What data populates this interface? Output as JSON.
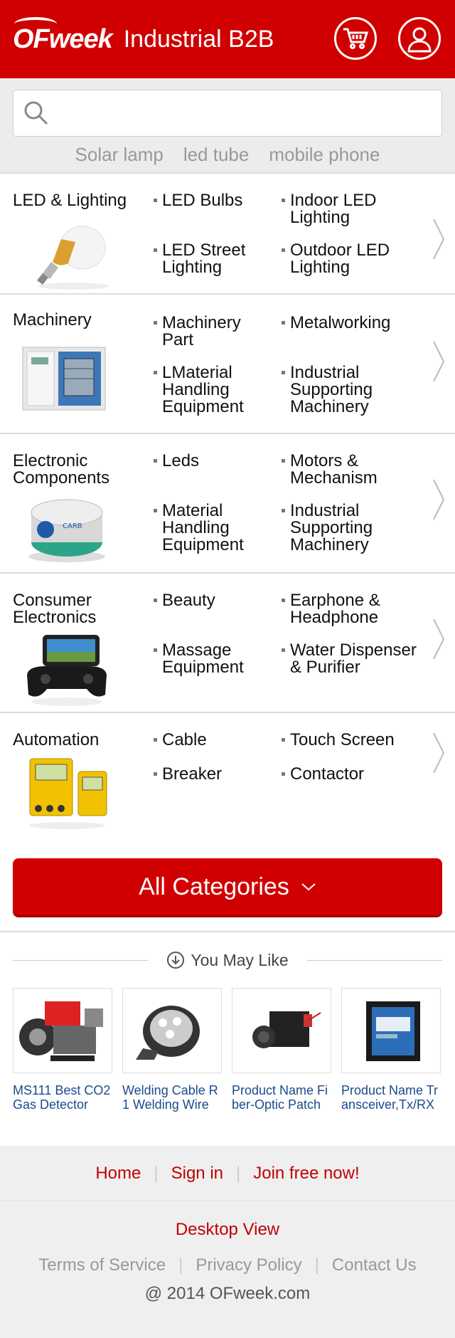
{
  "header": {
    "logo": "OFweek",
    "title": "Industrial B2B",
    "accent_color": "#d10000",
    "cart_icon": "cart-icon",
    "user_icon": "user-icon"
  },
  "search": {
    "placeholder": "",
    "hot_words": [
      "Solar lamp",
      "led tube",
      "mobile phone"
    ]
  },
  "categories": [
    {
      "name": "LED & Lighting",
      "subs": [
        "LED Bulbs",
        "Indoor LED Lighting",
        "LED Street Lighting",
        "Outdoor LED Lighting"
      ]
    },
    {
      "name": "Machinery",
      "subs": [
        "Machinery Part",
        "Metalworking",
        "LMaterial Handling Equipment",
        "Industrial Supporting Machinery"
      ]
    },
    {
      "name": "Electronic Components",
      "subs": [
        "Leds",
        "Motors & Mechanism",
        "Material Handling Equipment",
        "Industrial Supporting Machinery"
      ]
    },
    {
      "name": "Consumer Electronics",
      "subs": [
        "Beauty",
        "Earphone & Headphone",
        "Massage Equipment",
        "Water Dispenser & Purifier"
      ]
    },
    {
      "name": "Automation",
      "subs": [
        "Cable",
        "Touch Screen",
        "Breaker",
        "Contactor"
      ]
    }
  ],
  "all_categories": "All Categories",
  "you_may_like": {
    "title": "You May Like",
    "products": [
      {
        "name": "MS111 Best CO2 Gas Detector"
      },
      {
        "name": "Welding Cable R1 Welding Wire"
      },
      {
        "name": "Product Name Fiber-Optic Patch"
      },
      {
        "name": "Product Name Transceiver,Tx/RX"
      }
    ]
  },
  "footer": {
    "home": "Home",
    "sign_in": "Sign in",
    "join": "Join free now!",
    "desktop_view": "Desktop View",
    "terms": "Terms of Service",
    "privacy": "Privacy Policy",
    "contact": "Contact Us",
    "copyright": "@ 2014 OFweek.com"
  }
}
